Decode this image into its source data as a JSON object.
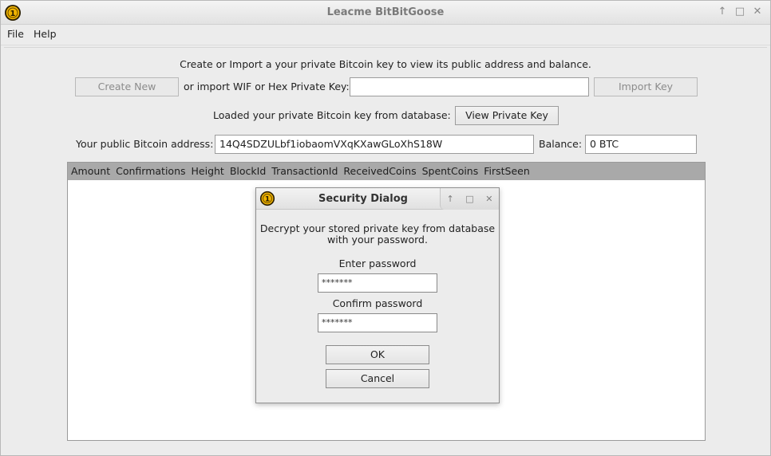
{
  "window": {
    "title": "Leacme BitBitGoose",
    "controls": [
      "maximize-up",
      "restore",
      "close"
    ]
  },
  "menu": {
    "file": "File",
    "help": "Help"
  },
  "main": {
    "intro_text": "Create or Import a your private Bitcoin key to view its public address and balance.",
    "create_new_label": "Create New",
    "import_label": "or import WIF or Hex Private Key:",
    "import_field_value": "",
    "import_key_label": "Import Key",
    "loaded_text": "Loaded your private Bitcoin key from database:",
    "view_private_key_label": "View Private Key",
    "public_address_label": "Your public Bitcoin address:",
    "public_address_value": "14Q4SDZULbf1iobaomVXqKXawGLoXhS18W",
    "balance_label": "Balance:",
    "balance_value": "0 BTC"
  },
  "table": {
    "columns": [
      "Amount",
      "Confirmations",
      "Height",
      "BlockId",
      "TransactionId",
      "ReceivedCoins",
      "SpentCoins",
      "FirstSeen"
    ]
  },
  "dialog": {
    "title": "Security Dialog",
    "message_line1": "Decrypt your stored private key from database",
    "message_line2": "with your password.",
    "enter_password_label": "Enter password",
    "enter_password_value": "*******",
    "confirm_password_label": "Confirm password",
    "confirm_password_value": "*******",
    "ok_label": "OK",
    "cancel_label": "Cancel"
  },
  "colors": {
    "accent_coin": "#f0b400",
    "table_header": "#a9a9a9"
  }
}
